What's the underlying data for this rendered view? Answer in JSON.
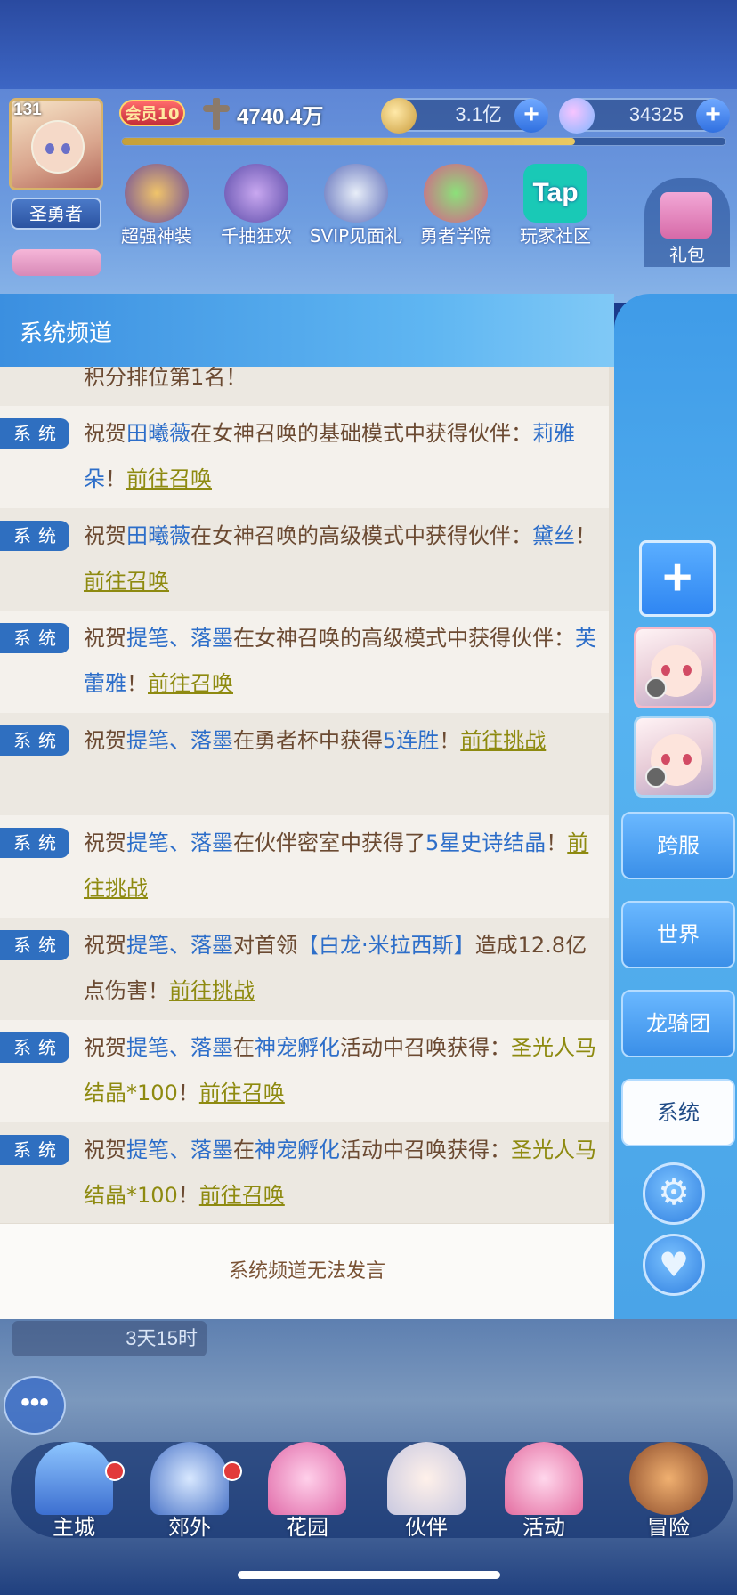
{
  "hud": {
    "level": "131",
    "title": "圣勇者",
    "vip": "会员10",
    "power": "4740.4万",
    "xp_fraction": 0.75,
    "gold": "3.1亿",
    "gems": "34325",
    "plus": "+"
  },
  "features": [
    {
      "label": "超强神装",
      "icon": "armor-chest-icon"
    },
    {
      "label": "千抽狂欢",
      "icon": "card-icon"
    },
    {
      "label": "SVIP见面礼",
      "icon": "svip-icon"
    },
    {
      "label": "勇者学院",
      "icon": "academy-icon"
    },
    {
      "label": "玩家社区",
      "icon": "tap-icon"
    }
  ],
  "features_tap": "Tap",
  "gift_label": "礼包",
  "chat": {
    "header": "系统频道",
    "tag": "系统",
    "partial_top": "积分排位第1名！",
    "footer": "系统频道无法发言",
    "messages": [
      {
        "p1": "祝贺",
        "name": "田曦薇",
        "p2": "在女神召唤的基础模式中获得伙伴：",
        "item": "莉雅朵",
        "p3": "！",
        "link": "前往召唤"
      },
      {
        "p1": "祝贺",
        "name": "田曦薇",
        "p2": "在女神召唤的高级模式中获得伙伴：",
        "item": "黛丝",
        "p3": "！",
        "link": "前往召唤"
      },
      {
        "p1": "祝贺",
        "name": "提笔、落墨",
        "p2": "在女神召唤的高级模式中获得伙伴：",
        "item": "芙蕾雅",
        "p3": "！",
        "link": "前往召唤"
      },
      {
        "p1": "祝贺",
        "name": "提笔、落墨",
        "p2": "在勇者杯中获得",
        "item": "5连胜",
        "p3": "！",
        "link": "前往挑战"
      },
      {
        "p1": "祝贺",
        "name": "提笔、落墨",
        "p2": "在伙伴密室中获得了",
        "item": "5星史诗结晶",
        "p3": "！",
        "link": "前往挑战"
      },
      {
        "p1": "祝贺",
        "name": "提笔、落墨",
        "p2": "对首领",
        "item": "【白龙·米拉西斯】",
        "p3": "造成12.8亿点伤害！",
        "link": "前往挑战"
      },
      {
        "p1": "祝贺",
        "name": "提笔、落墨",
        "p2": "在",
        "item": "神宠孵化",
        "p3": "活动中召唤获得：",
        "item2": "圣光人马结晶*100",
        "p4": "！",
        "link": "前往召唤"
      },
      {
        "p1": "祝贺",
        "name": "提笔、落墨",
        "p2": "在",
        "item": "神宠孵化",
        "p3": "活动中召唤获得：",
        "item2": "圣光人马结晶*100",
        "p4": "！",
        "link": "前往召唤"
      }
    ]
  },
  "side": {
    "add": "+",
    "channels": [
      "跨服",
      "世界",
      "龙骑团",
      "系统"
    ],
    "active": "系统"
  },
  "timer": "3天15时",
  "chat_bubble": "•••",
  "nav": [
    "主城",
    "郊外",
    "花园",
    "伙伴",
    "活动",
    "冒险"
  ],
  "colors": {
    "accent": "#2f6fc0",
    "link": "#8e8a10",
    "message_text": "#6b4a32"
  }
}
